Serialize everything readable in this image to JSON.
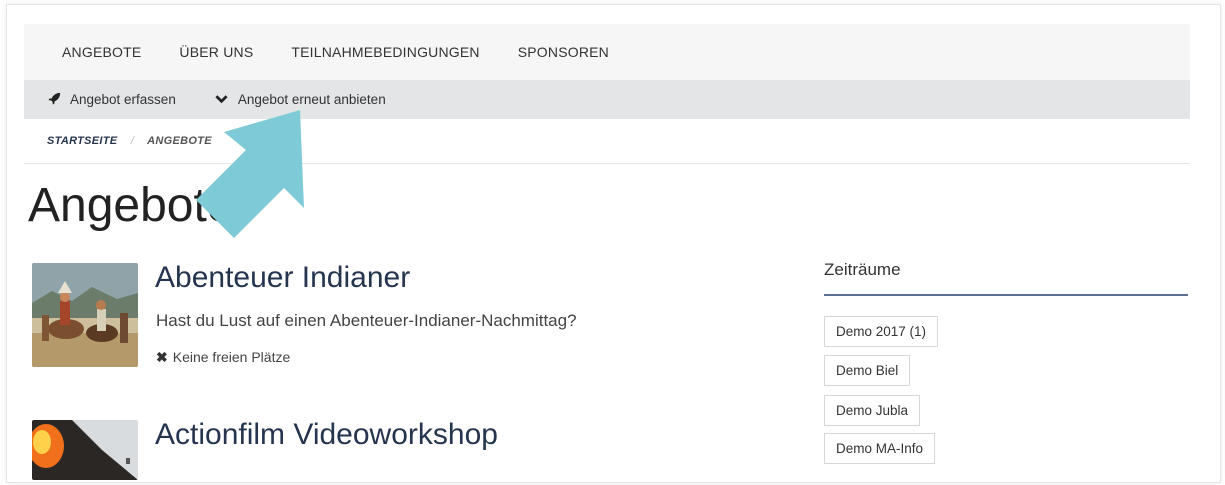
{
  "nav": {
    "items": [
      {
        "label": "ANGEBOTE"
      },
      {
        "label": "ÜBER UNS"
      },
      {
        "label": "TEILNAHMEBEDINGUNGEN"
      },
      {
        "label": "SPONSOREN"
      }
    ]
  },
  "actions": {
    "create": {
      "label": "Angebot erfassen",
      "icon": "rocket-icon"
    },
    "reoffer": {
      "label": "Angebot erneut anbieten",
      "icon": "chevron-down-icon"
    }
  },
  "breadcrumb": {
    "home": "STARTSEITE",
    "separator": "/",
    "current": "ANGEBOTE"
  },
  "page": {
    "title": "Angebote"
  },
  "offers": [
    {
      "title": "Abenteuer Indianer",
      "description": "Hast du Lust auf einen Abenteuer-Indianer-Nachmittag?",
      "status": "Keine freien Plätze"
    },
    {
      "title": "Actionfilm Videoworkshop"
    }
  ],
  "sidebar": {
    "title": "Zeiträume",
    "periods": [
      {
        "label": "Demo 2017 (1)"
      },
      {
        "label": "Demo Biel"
      },
      {
        "label": "Demo Jubla"
      },
      {
        "label": "Demo MA-Info"
      }
    ]
  },
  "colors": {
    "accent": "#26354f",
    "annotation_arrow": "#7ecad6",
    "sidebar_line": "#5b7196",
    "actionbar": "#e3e5e7"
  }
}
